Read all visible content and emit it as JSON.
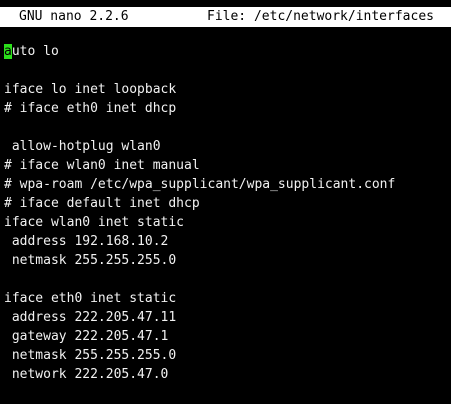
{
  "titlebar": {
    "app": "GNU nano 2.2.6",
    "file": "File: /etc/network/interfaces"
  },
  "editor": {
    "cursor_char": "a",
    "lines": [
      "auto lo",
      "",
      "iface lo inet loopback",
      "# iface eth0 inet dhcp",
      "",
      " allow-hotplug wlan0",
      "# iface wlan0 inet manual",
      "# wpa-roam /etc/wpa_supplicant/wpa_supplicant.conf",
      "# iface default inet dhcp",
      "iface wlan0 inet static",
      " address 192.168.10.2",
      " netmask 255.255.255.0",
      "",
      "iface eth0 inet static",
      " address 222.205.47.11",
      " gateway 222.205.47.1",
      " netmask 255.255.255.0",
      " network 222.205.47.0"
    ],
    "first_line_rest": "uto lo"
  },
  "colors": {
    "background": "#000000",
    "text": "#f2f2f2",
    "titlebar_bg": "#ffffff",
    "titlebar_text": "#000000",
    "cursor": "#2ce01b"
  }
}
